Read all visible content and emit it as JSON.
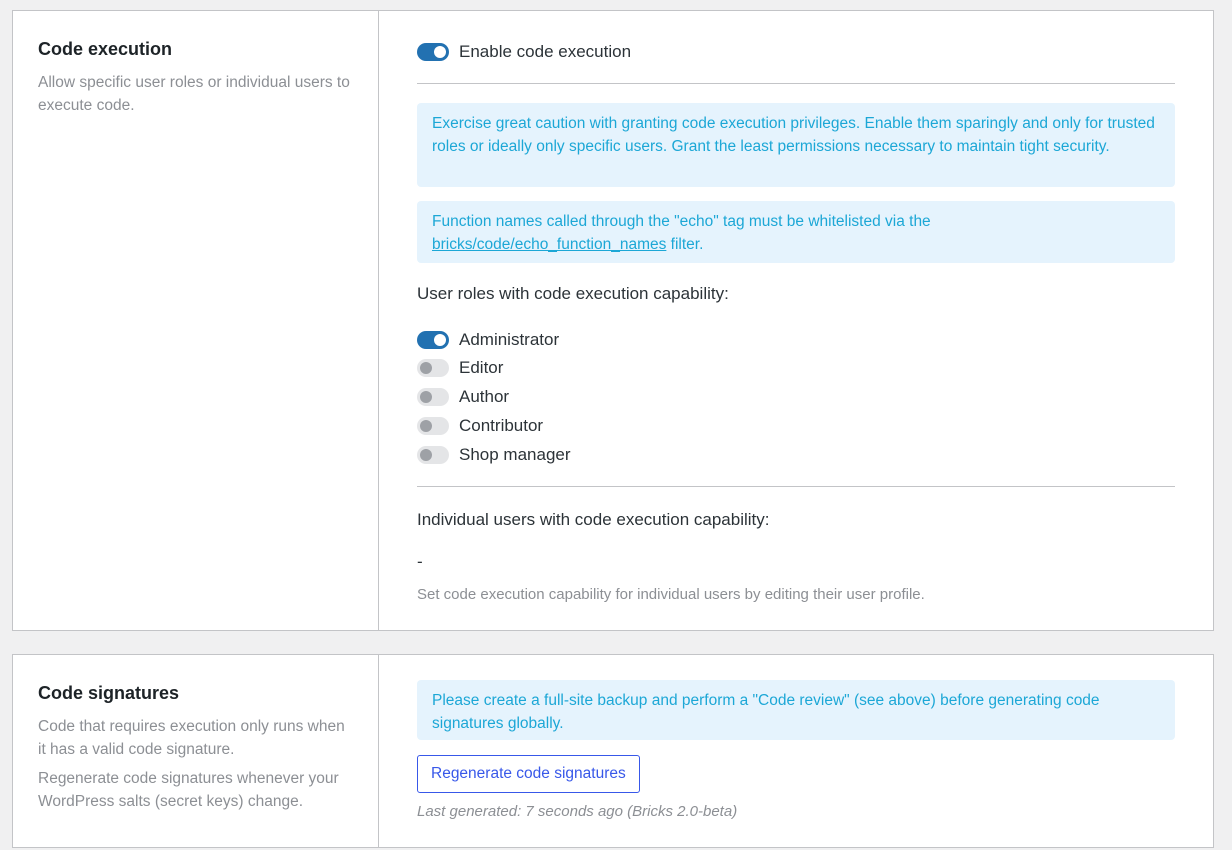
{
  "code_execution": {
    "title": "Code execution",
    "description": "Allow specific user roles or individual users to execute code.",
    "enable_label": "Enable code execution",
    "enable_on": true,
    "warning_notice": "Exercise great caution with granting code execution privileges. Enable them sparingly and only for trusted roles or ideally only specific users. Grant the least permissions necessary to maintain tight security.",
    "echo_notice_before": "Function names called through the \"echo\" tag must be whitelisted via the",
    "echo_notice_link": "bricks/code/echo_function_names",
    "echo_notice_after": " filter.",
    "roles_heading": "User roles with code execution capability:",
    "roles": [
      {
        "label": "Administrator",
        "on": true
      },
      {
        "label": "Editor",
        "on": false
      },
      {
        "label": "Author",
        "on": false
      },
      {
        "label": "Contributor",
        "on": false
      },
      {
        "label": "Shop manager",
        "on": false
      }
    ],
    "users_heading": "Individual users with code execution capability:",
    "users_value": "-",
    "users_help": "Set code execution capability for individual users by editing their user profile."
  },
  "code_signatures": {
    "title": "Code signatures",
    "description_1": "Code that requires execution only runs when it has a valid code signature.",
    "description_2": "Regenerate code signatures whenever your WordPress salts (secret keys) change.",
    "notice": "Please create a full-site backup and perform a \"Code review\" (see above) before generating code signatures globally.",
    "button_label": "Regenerate code signatures",
    "last_generated": "Last generated: 7 seconds ago (Bricks 2.0-beta)"
  }
}
